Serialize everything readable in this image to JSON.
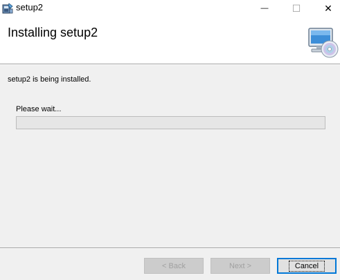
{
  "window": {
    "title": "setup2",
    "minimize_glyph": "—",
    "maximize_glyph": "☐",
    "close_glyph": "✕"
  },
  "header": {
    "title": "Installing setup2",
    "icon": "computer-cd-icon"
  },
  "content": {
    "status": "setup2 is being installed.",
    "wait_label": "Please wait...",
    "progress_percent": 0
  },
  "buttons": {
    "back": "< Back",
    "next": "Next >",
    "cancel": "Cancel"
  },
  "colors": {
    "accent": "#0078d7",
    "content_bg": "#f0f0f0",
    "progress_fill": "#06b025"
  }
}
